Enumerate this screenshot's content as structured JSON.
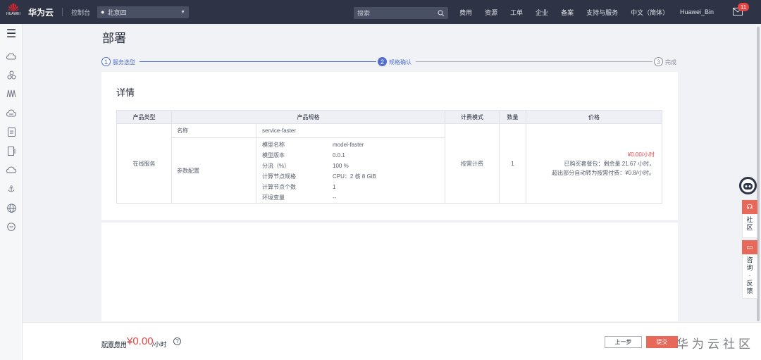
{
  "topbar": {
    "logo_text": "HUAWEI",
    "brand": "华为云",
    "console": "控制台",
    "region": "北京四",
    "search_placeholder": "搜索",
    "menu": [
      "费用",
      "资源",
      "工单",
      "企业",
      "备案",
      "支持与服务",
      "中文（简体）"
    ],
    "user": "Huawei_Bin",
    "message_count": "11"
  },
  "page": {
    "title": "部署"
  },
  "steps": [
    {
      "num": "1",
      "label": "服务选型",
      "state": "done"
    },
    {
      "num": "2",
      "label": "规格确认",
      "state": "active"
    },
    {
      "num": "3",
      "label": "完成",
      "state": "todo"
    }
  ],
  "detail": {
    "title": "详情",
    "headers": [
      "产品类型",
      "产品规格",
      "计费模式",
      "数量",
      "价格"
    ],
    "product_type": "在线服务",
    "name_label": "名称",
    "name_value": "service-faster",
    "params_label": "参数配置",
    "params": [
      {
        "k": "模型名称",
        "v": "model-faster"
      },
      {
        "k": "模型版本",
        "v": "0.0.1"
      },
      {
        "k": "分流（%）",
        "v": "100 %"
      },
      {
        "k": "计算节点规格",
        "v": "CPU：2 核 8 GiB"
      },
      {
        "k": "计算节点个数",
        "v": "1"
      },
      {
        "k": "环境变量",
        "v": "--"
      }
    ],
    "billing_mode": "按需计费",
    "quantity": "1",
    "price": "¥0.00/小时",
    "price_note1": "已购买套餐包：剩余量 21.67 小时，",
    "price_note2": "超出部分自动转为按需付费：¥0.8/小时。"
  },
  "bottom": {
    "fee_label": "配置费用",
    "fee_price": "¥0.00",
    "fee_unit": "/小时",
    "help": "?",
    "prev_button": "上一步",
    "submit_button": "提交",
    "watermark": "华为云社区"
  },
  "floating": {
    "community": "社区",
    "feedback": "咨询·反馈"
  },
  "colors": {
    "topbar": "#2e3446",
    "accent": "#526ecc",
    "price": "#e54545",
    "submit": "#e8685a"
  }
}
